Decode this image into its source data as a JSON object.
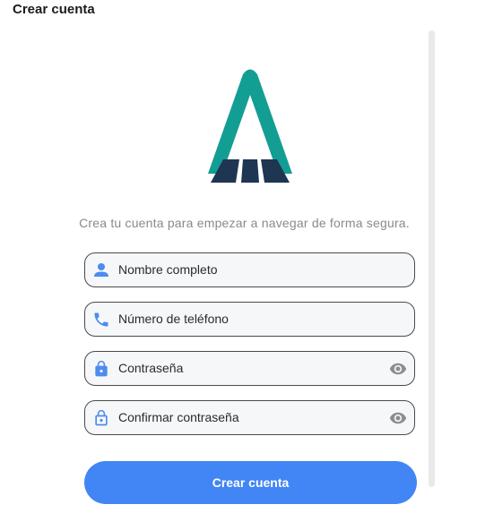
{
  "header": {
    "title": "Crear cuenta"
  },
  "main": {
    "subtitle": "Crea tu cuenta para empezar a navegar de forma segura.",
    "fields": [
      {
        "placeholder": "Nombre completo",
        "icon": "person-icon"
      },
      {
        "placeholder": "Número de teléfono",
        "icon": "phone-icon"
      },
      {
        "placeholder": "Contraseña",
        "icon": "lock-icon",
        "toggle_icon": "eye-icon"
      },
      {
        "placeholder": "Confirmar contraseña",
        "icon": "lock-outline-icon",
        "toggle_icon": "eye-icon"
      }
    ],
    "submit_label": "Crear cuenta"
  },
  "colors": {
    "accent": "#4285f4",
    "logo_teal": "#139e94",
    "logo_navy": "#1f3653"
  }
}
